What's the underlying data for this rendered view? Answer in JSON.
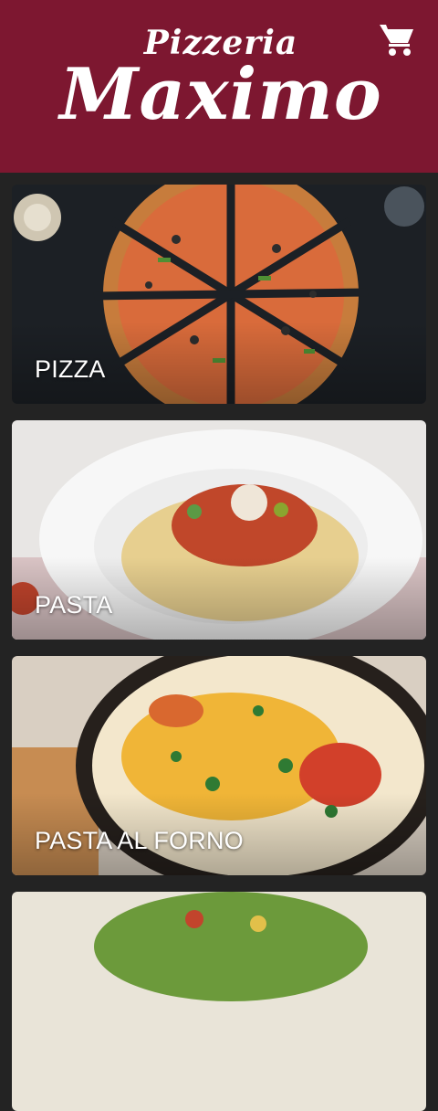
{
  "header": {
    "logo_top": "Pizzeria",
    "logo_main": "Maximo",
    "background_color": "#7d1730",
    "cart_icon": "shopping-cart-icon"
  },
  "categories": [
    {
      "label": "PIZZA"
    },
    {
      "label": "PASTA"
    },
    {
      "label": "PASTA AL FORNO"
    },
    {
      "label": ""
    }
  ]
}
